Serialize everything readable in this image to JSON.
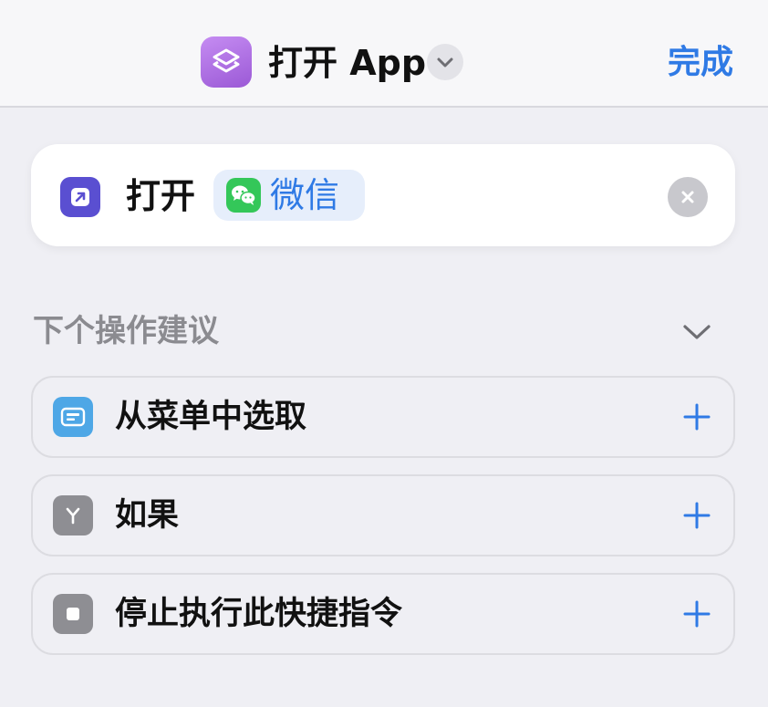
{
  "header": {
    "title": "打开 App",
    "done_label": "完成"
  },
  "action": {
    "verb": "打开",
    "app_name": "微信",
    "icons": {
      "action": "open-app-icon",
      "app": "wechat-icon",
      "clear": "clear-icon"
    }
  },
  "suggestions": {
    "title": "下个操作建议",
    "items": [
      {
        "label": "从菜单中选取",
        "icon": "choose-from-menu-icon",
        "color": "#4ea7e6"
      },
      {
        "label": "如果",
        "icon": "if-branch-icon",
        "color": "#8e8e93"
      },
      {
        "label": "停止执行此快捷指令",
        "icon": "stop-icon",
        "color": "#8e8e93"
      }
    ]
  },
  "colors": {
    "accent": "#2f7ae5",
    "app_icon": "#a66ee3",
    "action_icon": "#5a4fd1",
    "wechat": "#34c759",
    "background": "#efeff4"
  }
}
